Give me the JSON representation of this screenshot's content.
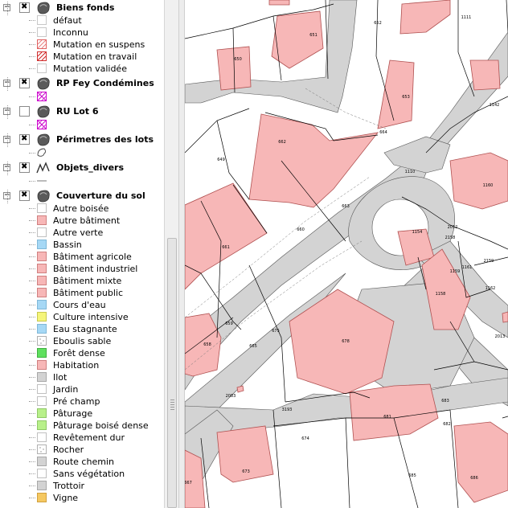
{
  "legend": {
    "groups": [
      {
        "label": "Biens fonds",
        "checked": true,
        "icon": "vector-polygon-layer-icon",
        "items": [
          {
            "label": "défaut",
            "fill": "#ffffff",
            "border": "#c8c8c8",
            "pattern": "none"
          },
          {
            "label": "Inconnu",
            "fill": "#ffffff",
            "border": "#c8c8c8",
            "pattern": "none"
          },
          {
            "label": "Mutation en suspens",
            "fill": "#ffffff",
            "border": "#e06060",
            "pattern": "hatch-light"
          },
          {
            "label": "Mutation en travail",
            "fill": "#ffffff",
            "border": "#d03030",
            "pattern": "hatch-red"
          },
          {
            "label": "Mutation validée",
            "fill": "#ffffff",
            "border": "#c8c8c8",
            "pattern": "none"
          }
        ]
      },
      {
        "label": "RP Fey Condémines",
        "checked": true,
        "icon": "vector-polygon-layer-icon",
        "items": [
          {
            "label": "",
            "fill": "#ffffff",
            "border": "#cc00cc",
            "pattern": "cross-magenta"
          }
        ]
      },
      {
        "label": "RU Lot 6",
        "checked": false,
        "icon": "vector-polygon-layer-icon",
        "items": [
          {
            "label": "",
            "fill": "#ffffff",
            "border": "#cc00cc",
            "pattern": "cross-magenta"
          }
        ]
      },
      {
        "label": "Périmetres des lots",
        "checked": true,
        "icon": "vector-polygon-layer-icon",
        "items": [
          {
            "label": "",
            "fill": "#ffffff",
            "border": "#555555",
            "pattern": "outline-shape"
          }
        ]
      },
      {
        "label": "Objets_divers",
        "checked": true,
        "icon": "vector-line-layer-icon",
        "items": [
          {
            "label": "",
            "fill": "#ffffff",
            "border": "#777777",
            "pattern": "line"
          }
        ]
      },
      {
        "label": "Couverture du sol",
        "checked": true,
        "icon": "vector-polygon-layer-icon",
        "items": [
          {
            "label": "Autre boisée",
            "fill": "#ffffff",
            "border": "#c0c0c0",
            "pattern": "none"
          },
          {
            "label": "Autre bâtiment",
            "fill": "#f7b7b7",
            "border": "#d08080",
            "pattern": "none"
          },
          {
            "label": "Autre verte",
            "fill": "#ffffff",
            "border": "#c0c0c0",
            "pattern": "none"
          },
          {
            "label": "Bassin",
            "fill": "#a6d8f5",
            "border": "#80b8d8",
            "pattern": "none"
          },
          {
            "label": "Bâtiment agricole",
            "fill": "#f7b7b7",
            "border": "#d08080",
            "pattern": "none"
          },
          {
            "label": "Bâtiment industriel",
            "fill": "#f7b7b7",
            "border": "#d08080",
            "pattern": "none"
          },
          {
            "label": "Bâtiment mixte",
            "fill": "#f7b7b7",
            "border": "#d08080",
            "pattern": "none"
          },
          {
            "label": "Bâtiment public",
            "fill": "#f7b7b7",
            "border": "#d08080",
            "pattern": "none"
          },
          {
            "label": "Cours d'eau",
            "fill": "#a6d8f5",
            "border": "#80b8d8",
            "pattern": "none"
          },
          {
            "label": "Culture intensive",
            "fill": "#f5f57a",
            "border": "#c8c850",
            "pattern": "none"
          },
          {
            "label": "Eau stagnante",
            "fill": "#a6d8f5",
            "border": "#80b8d8",
            "pattern": "none"
          },
          {
            "label": "Eboulis sable",
            "fill": "#ffffff",
            "border": "#b0b0b0",
            "pattern": "dotted"
          },
          {
            "label": "Forêt dense",
            "fill": "#5fe05f",
            "border": "#40b040",
            "pattern": "none"
          },
          {
            "label": "Habitation",
            "fill": "#f7b7b7",
            "border": "#d08080",
            "pattern": "none"
          },
          {
            "label": "Ilot",
            "fill": "#d3d3d3",
            "border": "#a8a8a8",
            "pattern": "none"
          },
          {
            "label": "Jardin",
            "fill": "#ffffff",
            "border": "#c0c0c0",
            "pattern": "none"
          },
          {
            "label": "Pré champ",
            "fill": "#ffffff",
            "border": "#c0c0c0",
            "pattern": "none"
          },
          {
            "label": "Pâturage",
            "fill": "#b8f08a",
            "border": "#90c868",
            "pattern": "none"
          },
          {
            "label": "Pâturage boisé dense",
            "fill": "#b8f08a",
            "border": "#90c868",
            "pattern": "none"
          },
          {
            "label": "Revêtement dur",
            "fill": "#ffffff",
            "border": "#c0c0c0",
            "pattern": "none"
          },
          {
            "label": "Rocher",
            "fill": "#ffffff",
            "border": "#b0b0b0",
            "pattern": "dotted"
          },
          {
            "label": "Route chemin",
            "fill": "#d3d3d3",
            "border": "#a8a8a8",
            "pattern": "none"
          },
          {
            "label": "Sans végétation",
            "fill": "#ffffff",
            "border": "#c0c0c0",
            "pattern": "none"
          },
          {
            "label": "Trottoir",
            "fill": "#d3d3d3",
            "border": "#a8a8a8",
            "pattern": "none"
          },
          {
            "label": "Vigne",
            "fill": "#f5c860",
            "border": "#d0a040",
            "pattern": "none"
          }
        ]
      }
    ]
  },
  "map": {
    "colors": {
      "road": "#d3d3d3",
      "building": "#f7b7b7",
      "building_border": "#c07070",
      "parcel_line": "#000000",
      "background": "#ffffff"
    },
    "parcel_labels": [
      "651",
      "652",
      "650",
      "653",
      "1142",
      "1111",
      "664",
      "662",
      "649",
      "1110",
      "1160",
      "663",
      "660",
      "661",
      "2012",
      "1154",
      "2158",
      "1161",
      "2159",
      "1159",
      "1162",
      "1158",
      "659",
      "675",
      "678",
      "658",
      "665",
      "2013",
      "2083",
      "3193",
      "681",
      "683",
      "674",
      "682",
      "673",
      "685",
      "686",
      "667"
    ]
  }
}
